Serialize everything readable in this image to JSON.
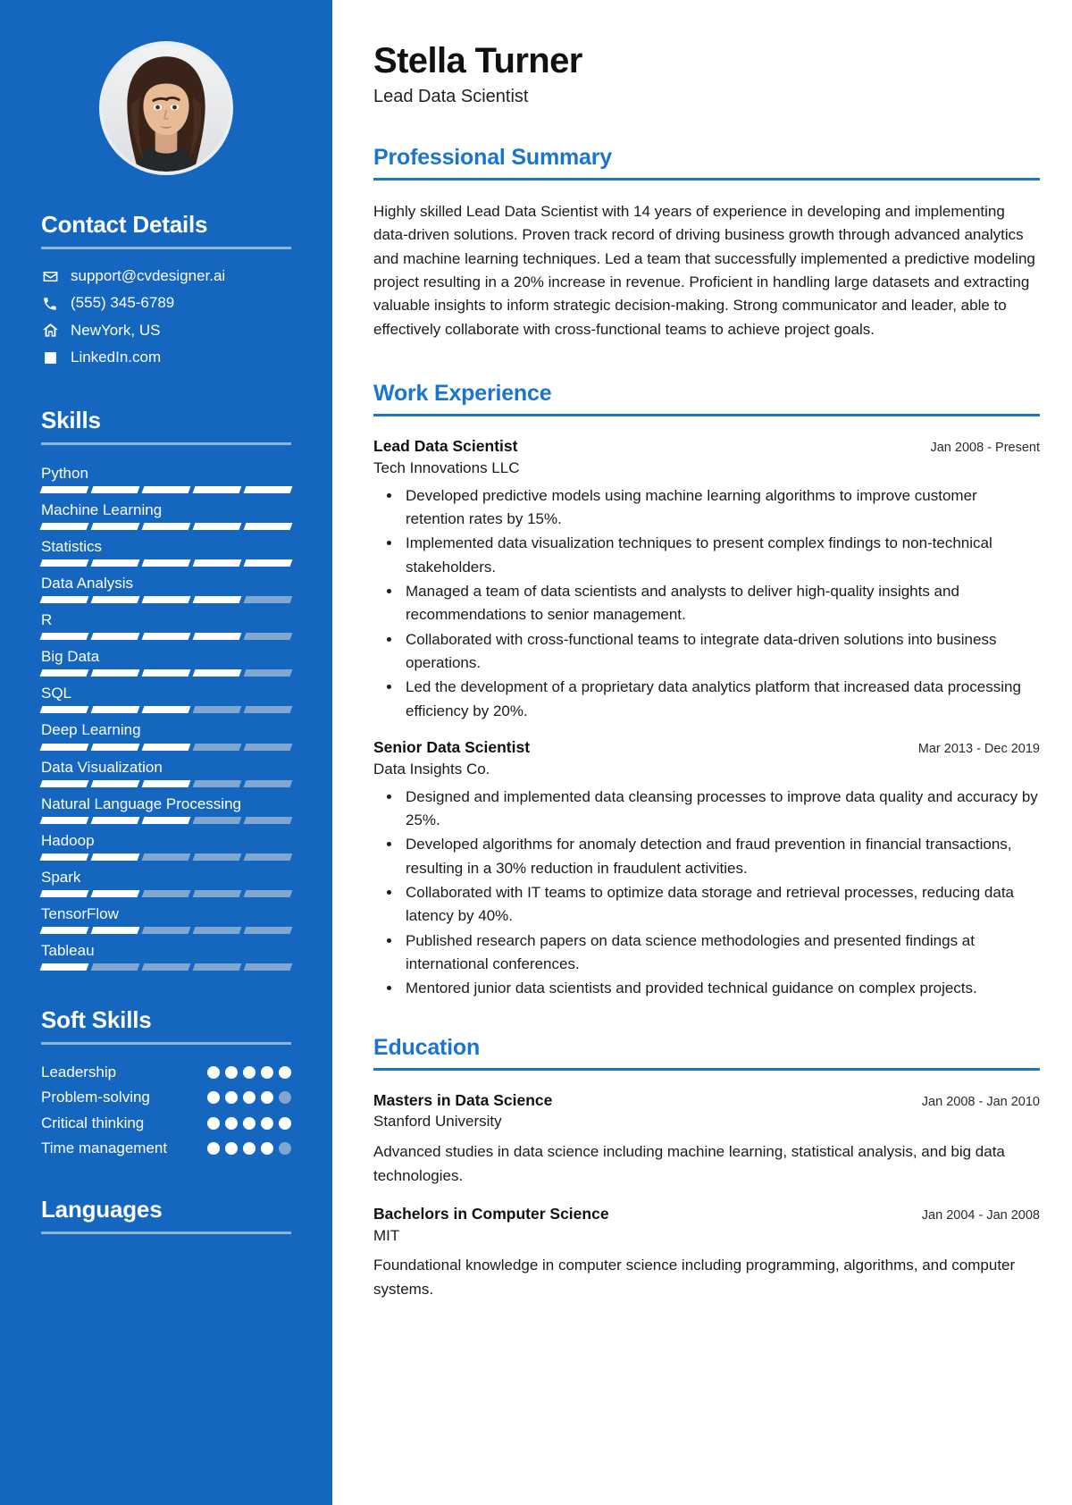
{
  "theme": {
    "sidebar_bg": "#1566bf",
    "accent": "#1a74d2",
    "muted_bar": "#7fa7d0",
    "rule": "#8fb4da"
  },
  "header": {
    "name": "Stella Turner",
    "job_title": "Lead Data Scientist"
  },
  "sidebar": {
    "contact": {
      "heading": "Contact Details",
      "items": [
        {
          "icon": "envelope-icon",
          "text": "support@cvdesigner.ai"
        },
        {
          "icon": "phone-icon",
          "text": "(555) 345-6789"
        },
        {
          "icon": "home-icon",
          "text": "NewYork, US"
        },
        {
          "icon": "linkedin-icon",
          "text": "LinkedIn.com"
        }
      ]
    },
    "skills": {
      "heading": "Skills",
      "max": 5,
      "items": [
        {
          "name": "Python",
          "level": 5
        },
        {
          "name": "Machine Learning",
          "level": 5
        },
        {
          "name": "Statistics",
          "level": 5
        },
        {
          "name": "Data Analysis",
          "level": 4
        },
        {
          "name": "R",
          "level": 4
        },
        {
          "name": "Big Data",
          "level": 4
        },
        {
          "name": "SQL",
          "level": 3
        },
        {
          "name": "Deep Learning",
          "level": 3
        },
        {
          "name": "Data Visualization",
          "level": 3
        },
        {
          "name": "Natural Language Processing",
          "level": 3
        },
        {
          "name": "Hadoop",
          "level": 2
        },
        {
          "name": "Spark",
          "level": 2
        },
        {
          "name": "TensorFlow",
          "level": 2
        },
        {
          "name": "Tableau",
          "level": 1
        }
      ]
    },
    "soft_skills": {
      "heading": "Soft Skills",
      "max": 5,
      "items": [
        {
          "name": "Leadership",
          "level": 5
        },
        {
          "name": "Problem-solving",
          "level": 4
        },
        {
          "name": "Critical thinking",
          "level": 5
        },
        {
          "name": "Time management",
          "level": 4
        }
      ]
    },
    "languages": {
      "heading": "Languages"
    }
  },
  "main": {
    "summary": {
      "heading": "Professional Summary",
      "text": "Highly skilled Lead Data Scientist with 14 years of experience in developing and implementing data-driven solutions. Proven track record of driving business growth through advanced analytics and machine learning techniques. Led a team that successfully implemented a predictive modeling project resulting in a 20% increase in revenue. Proficient in handling large datasets and extracting valuable insights to inform strategic decision-making. Strong communicator and leader, able to effectively collaborate with cross-functional teams to achieve project goals."
    },
    "work": {
      "heading": "Work Experience",
      "entries": [
        {
          "role": "Lead Data Scientist",
          "date": "Jan 2008 - Present",
          "org": "Tech Innovations LLC",
          "bullets": [
            "Developed predictive models using machine learning algorithms to improve customer retention rates by 15%.",
            "Implemented data visualization techniques to present complex findings to non-technical stakeholders.",
            "Managed a team of data scientists and analysts to deliver high-quality insights and recommendations to senior management.",
            "Collaborated with cross-functional teams to integrate data-driven solutions into business operations.",
            "Led the development of a proprietary data analytics platform that increased data processing efficiency by 20%."
          ]
        },
        {
          "role": "Senior Data Scientist",
          "date": "Mar 2013 - Dec 2019",
          "org": "Data Insights Co.",
          "bullets": [
            "Designed and implemented data cleansing processes to improve data quality and accuracy by 25%.",
            "Developed algorithms for anomaly detection and fraud prevention in financial transactions, resulting in a 30% reduction in fraudulent activities.",
            "Collaborated with IT teams to optimize data storage and retrieval processes, reducing data latency by 40%.",
            "Published research papers on data science methodologies and presented findings at international conferences.",
            "Mentored junior data scientists and provided technical guidance on complex projects."
          ]
        }
      ]
    },
    "education": {
      "heading": "Education",
      "entries": [
        {
          "degree": "Masters in Data Science",
          "date": "Jan 2008 - Jan 2010",
          "school": "Stanford University",
          "description": "Advanced studies in data science including machine learning, statistical analysis, and big data technologies."
        },
        {
          "degree": "Bachelors in Computer Science",
          "date": "Jan 2004 - Jan 2008",
          "school": "MIT",
          "description": "Foundational knowledge in computer science including programming, algorithms, and computer systems."
        }
      ]
    }
  }
}
